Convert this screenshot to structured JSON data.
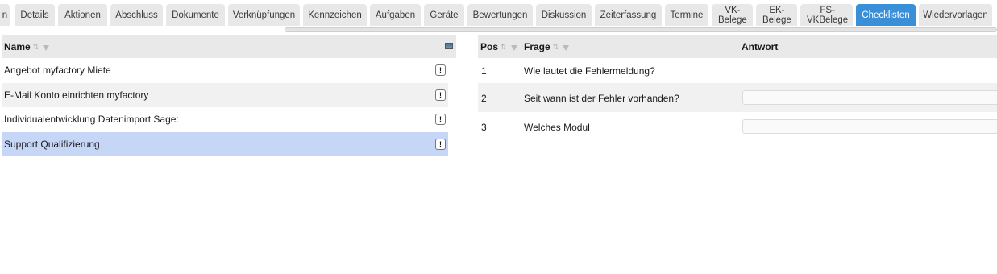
{
  "tabs": [
    {
      "label": "n",
      "active": false
    },
    {
      "label": "Details",
      "active": false
    },
    {
      "label": "Aktionen",
      "active": false
    },
    {
      "label": "Abschluss",
      "active": false
    },
    {
      "label": "Dokumente",
      "active": false
    },
    {
      "label": "Verknüpfungen",
      "active": false
    },
    {
      "label": "Kennzeichen",
      "active": false
    },
    {
      "label": "Aufgaben",
      "active": false
    },
    {
      "label": "Geräte",
      "active": false
    },
    {
      "label": "Bewertungen",
      "active": false
    },
    {
      "label": "Diskussion",
      "active": false
    },
    {
      "label": "Zeiterfassung",
      "active": false
    },
    {
      "label": "Termine",
      "active": false
    },
    {
      "label": "VK-\nBelege",
      "active": false
    },
    {
      "label": "EK-\nBelege",
      "active": false
    },
    {
      "label": "FS-\nVKBelege",
      "active": false
    },
    {
      "label": "Checklisten",
      "active": true
    },
    {
      "label": "Wiedervorlagen",
      "active": false
    }
  ],
  "left_grid": {
    "header": {
      "name": "Name"
    },
    "rows": [
      {
        "name": "Angebot myfactory Miete",
        "info": "!"
      },
      {
        "name": "E-Mail Konto einrichten myfactory",
        "info": "!"
      },
      {
        "name": "Individualentwicklung Datenimport Sage:",
        "info": "!"
      },
      {
        "name": "Support Qualifizierung",
        "info": "!",
        "selected": true
      }
    ]
  },
  "right_grid": {
    "header": {
      "pos": "Pos",
      "frage": "Frage",
      "antwort": "Antwort"
    },
    "rows": [
      {
        "pos": "1",
        "frage": "Wie lautet die Fehlermeldung?"
      },
      {
        "pos": "2",
        "frage": "Seit wann ist der Fehler vorhanden?"
      },
      {
        "pos": "3",
        "frage": "Welches Modul"
      }
    ]
  }
}
